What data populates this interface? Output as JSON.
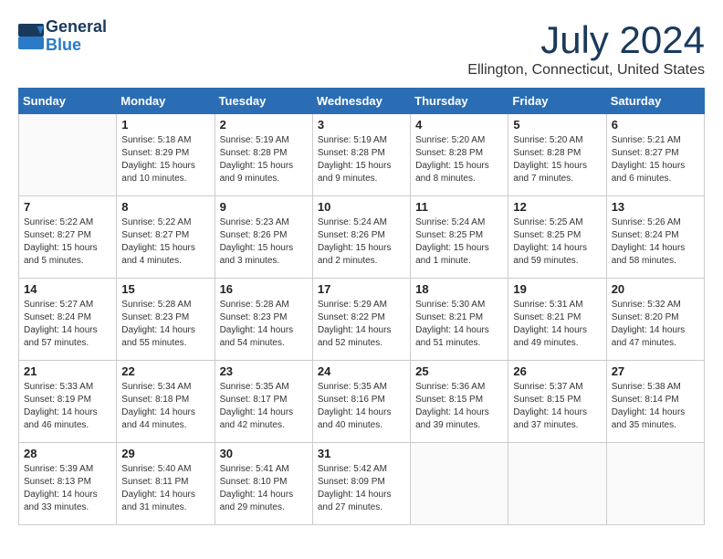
{
  "header": {
    "logo_line1": "General",
    "logo_line2": "Blue",
    "month_year": "July 2024",
    "location": "Ellington, Connecticut, United States"
  },
  "days_of_week": [
    "Sunday",
    "Monday",
    "Tuesday",
    "Wednesday",
    "Thursday",
    "Friday",
    "Saturday"
  ],
  "weeks": [
    [
      {
        "day": "",
        "sunrise": "",
        "sunset": "",
        "daylight": ""
      },
      {
        "day": "1",
        "sunrise": "Sunrise: 5:18 AM",
        "sunset": "Sunset: 8:29 PM",
        "daylight": "Daylight: 15 hours and 10 minutes."
      },
      {
        "day": "2",
        "sunrise": "Sunrise: 5:19 AM",
        "sunset": "Sunset: 8:28 PM",
        "daylight": "Daylight: 15 hours and 9 minutes."
      },
      {
        "day": "3",
        "sunrise": "Sunrise: 5:19 AM",
        "sunset": "Sunset: 8:28 PM",
        "daylight": "Daylight: 15 hours and 9 minutes."
      },
      {
        "day": "4",
        "sunrise": "Sunrise: 5:20 AM",
        "sunset": "Sunset: 8:28 PM",
        "daylight": "Daylight: 15 hours and 8 minutes."
      },
      {
        "day": "5",
        "sunrise": "Sunrise: 5:20 AM",
        "sunset": "Sunset: 8:28 PM",
        "daylight": "Daylight: 15 hours and 7 minutes."
      },
      {
        "day": "6",
        "sunrise": "Sunrise: 5:21 AM",
        "sunset": "Sunset: 8:27 PM",
        "daylight": "Daylight: 15 hours and 6 minutes."
      }
    ],
    [
      {
        "day": "7",
        "sunrise": "Sunrise: 5:22 AM",
        "sunset": "Sunset: 8:27 PM",
        "daylight": "Daylight: 15 hours and 5 minutes."
      },
      {
        "day": "8",
        "sunrise": "Sunrise: 5:22 AM",
        "sunset": "Sunset: 8:27 PM",
        "daylight": "Daylight: 15 hours and 4 minutes."
      },
      {
        "day": "9",
        "sunrise": "Sunrise: 5:23 AM",
        "sunset": "Sunset: 8:26 PM",
        "daylight": "Daylight: 15 hours and 3 minutes."
      },
      {
        "day": "10",
        "sunrise": "Sunrise: 5:24 AM",
        "sunset": "Sunset: 8:26 PM",
        "daylight": "Daylight: 15 hours and 2 minutes."
      },
      {
        "day": "11",
        "sunrise": "Sunrise: 5:24 AM",
        "sunset": "Sunset: 8:25 PM",
        "daylight": "Daylight: 15 hours and 1 minute."
      },
      {
        "day": "12",
        "sunrise": "Sunrise: 5:25 AM",
        "sunset": "Sunset: 8:25 PM",
        "daylight": "Daylight: 14 hours and 59 minutes."
      },
      {
        "day": "13",
        "sunrise": "Sunrise: 5:26 AM",
        "sunset": "Sunset: 8:24 PM",
        "daylight": "Daylight: 14 hours and 58 minutes."
      }
    ],
    [
      {
        "day": "14",
        "sunrise": "Sunrise: 5:27 AM",
        "sunset": "Sunset: 8:24 PM",
        "daylight": "Daylight: 14 hours and 57 minutes."
      },
      {
        "day": "15",
        "sunrise": "Sunrise: 5:28 AM",
        "sunset": "Sunset: 8:23 PM",
        "daylight": "Daylight: 14 hours and 55 minutes."
      },
      {
        "day": "16",
        "sunrise": "Sunrise: 5:28 AM",
        "sunset": "Sunset: 8:23 PM",
        "daylight": "Daylight: 14 hours and 54 minutes."
      },
      {
        "day": "17",
        "sunrise": "Sunrise: 5:29 AM",
        "sunset": "Sunset: 8:22 PM",
        "daylight": "Daylight: 14 hours and 52 minutes."
      },
      {
        "day": "18",
        "sunrise": "Sunrise: 5:30 AM",
        "sunset": "Sunset: 8:21 PM",
        "daylight": "Daylight: 14 hours and 51 minutes."
      },
      {
        "day": "19",
        "sunrise": "Sunrise: 5:31 AM",
        "sunset": "Sunset: 8:21 PM",
        "daylight": "Daylight: 14 hours and 49 minutes."
      },
      {
        "day": "20",
        "sunrise": "Sunrise: 5:32 AM",
        "sunset": "Sunset: 8:20 PM",
        "daylight": "Daylight: 14 hours and 47 minutes."
      }
    ],
    [
      {
        "day": "21",
        "sunrise": "Sunrise: 5:33 AM",
        "sunset": "Sunset: 8:19 PM",
        "daylight": "Daylight: 14 hours and 46 minutes."
      },
      {
        "day": "22",
        "sunrise": "Sunrise: 5:34 AM",
        "sunset": "Sunset: 8:18 PM",
        "daylight": "Daylight: 14 hours and 44 minutes."
      },
      {
        "day": "23",
        "sunrise": "Sunrise: 5:35 AM",
        "sunset": "Sunset: 8:17 PM",
        "daylight": "Daylight: 14 hours and 42 minutes."
      },
      {
        "day": "24",
        "sunrise": "Sunrise: 5:35 AM",
        "sunset": "Sunset: 8:16 PM",
        "daylight": "Daylight: 14 hours and 40 minutes."
      },
      {
        "day": "25",
        "sunrise": "Sunrise: 5:36 AM",
        "sunset": "Sunset: 8:15 PM",
        "daylight": "Daylight: 14 hours and 39 minutes."
      },
      {
        "day": "26",
        "sunrise": "Sunrise: 5:37 AM",
        "sunset": "Sunset: 8:15 PM",
        "daylight": "Daylight: 14 hours and 37 minutes."
      },
      {
        "day": "27",
        "sunrise": "Sunrise: 5:38 AM",
        "sunset": "Sunset: 8:14 PM",
        "daylight": "Daylight: 14 hours and 35 minutes."
      }
    ],
    [
      {
        "day": "28",
        "sunrise": "Sunrise: 5:39 AM",
        "sunset": "Sunset: 8:13 PM",
        "daylight": "Daylight: 14 hours and 33 minutes."
      },
      {
        "day": "29",
        "sunrise": "Sunrise: 5:40 AM",
        "sunset": "Sunset: 8:11 PM",
        "daylight": "Daylight: 14 hours and 31 minutes."
      },
      {
        "day": "30",
        "sunrise": "Sunrise: 5:41 AM",
        "sunset": "Sunset: 8:10 PM",
        "daylight": "Daylight: 14 hours and 29 minutes."
      },
      {
        "day": "31",
        "sunrise": "Sunrise: 5:42 AM",
        "sunset": "Sunset: 8:09 PM",
        "daylight": "Daylight: 14 hours and 27 minutes."
      },
      {
        "day": "",
        "sunrise": "",
        "sunset": "",
        "daylight": ""
      },
      {
        "day": "",
        "sunrise": "",
        "sunset": "",
        "daylight": ""
      },
      {
        "day": "",
        "sunrise": "",
        "sunset": "",
        "daylight": ""
      }
    ]
  ]
}
